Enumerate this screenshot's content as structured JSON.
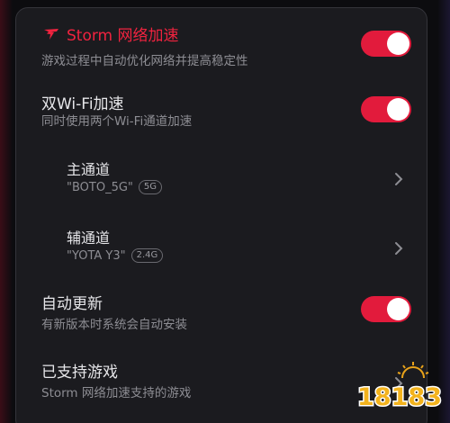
{
  "settings": {
    "storm": {
      "title": "Storm 网络加速",
      "subtitle": "游戏过程中自动优化网络并提高稳定性",
      "enabled": true
    },
    "dual_wifi": {
      "title": "双Wi-Fi加速",
      "subtitle": "同时使用两个Wi-Fi通道加速",
      "enabled": true
    },
    "primary_channel": {
      "title": "主通道",
      "network": "\"BOTO_5G\"",
      "band": "5G"
    },
    "secondary_channel": {
      "title": "辅通道",
      "network": "\"YOTA Y3\"",
      "band": "2.4G"
    },
    "auto_update": {
      "title": "自动更新",
      "subtitle": "有新版本时系统会自动安装",
      "enabled": true
    },
    "supported_games": {
      "title": "已支持游戏",
      "subtitle": "Storm 网络加速支持的游戏"
    }
  },
  "watermark": {
    "text": "18183"
  },
  "colors": {
    "accent": "#e21b3c",
    "storm_red": "#f0233f",
    "panel": "#1b1b1f",
    "text_primary": "#e6e6e9",
    "text_secondary": "#8d8d93",
    "watermark_gold": "#e8a21a"
  },
  "icons": {
    "storm_logo": "storm-logo-icon",
    "chevron": "chevron-right-icon"
  }
}
